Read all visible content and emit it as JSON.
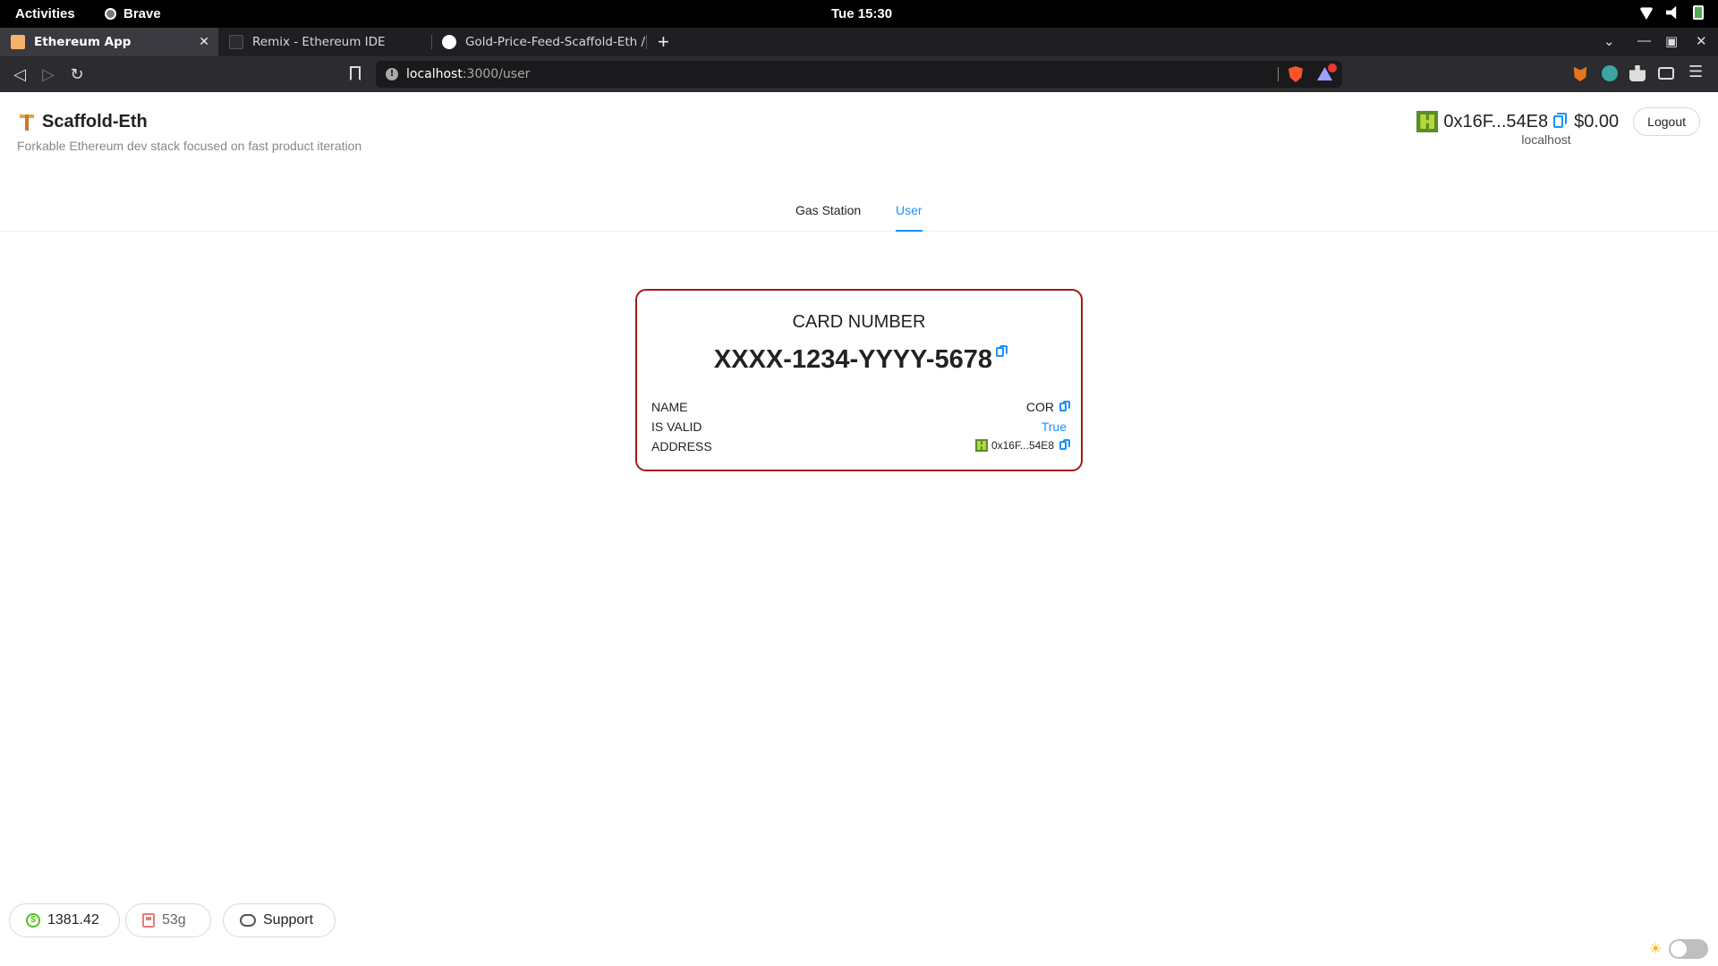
{
  "system": {
    "activities": "Activities",
    "app_name": "Brave",
    "clock": "Tue 15:30"
  },
  "browser": {
    "tabs": [
      {
        "title": "Ethereum App",
        "favicon": "app-icon",
        "active": true
      },
      {
        "title": "Remix - Ethereum IDE",
        "favicon": "remix-icon",
        "active": false
      },
      {
        "title": "Gold-Price-Feed-Scaffold-Eth /",
        "favicon": "github-icon",
        "active": false
      }
    ],
    "url_host": "localhost",
    "url_path": ":3000/user"
  },
  "header": {
    "title": "Scaffold-Eth",
    "subtitle": "Forkable Ethereum dev stack focused on fast product iteration"
  },
  "account": {
    "address": "0x16F...54E8",
    "balance": "$0.00",
    "network": "localhost",
    "logout_label": "Logout"
  },
  "nav": {
    "items": [
      {
        "label": "Gas Station",
        "active": false
      },
      {
        "label": "User",
        "active": true
      }
    ]
  },
  "card": {
    "label": "CARD NUMBER",
    "number": "XXXX-1234-YYYY-5678",
    "rows": [
      {
        "key": "NAME",
        "value": "COR"
      },
      {
        "key": "IS VALID",
        "value": "True"
      },
      {
        "key": "ADDRESS",
        "value": "0x16F...54E8"
      }
    ],
    "border_color": "#a11a1a"
  },
  "footer": {
    "price": "1381.42",
    "gas": "53g",
    "support_label": "Support"
  },
  "colors": {
    "accent": "#1890ff",
    "card_border": "#a11a1a"
  }
}
